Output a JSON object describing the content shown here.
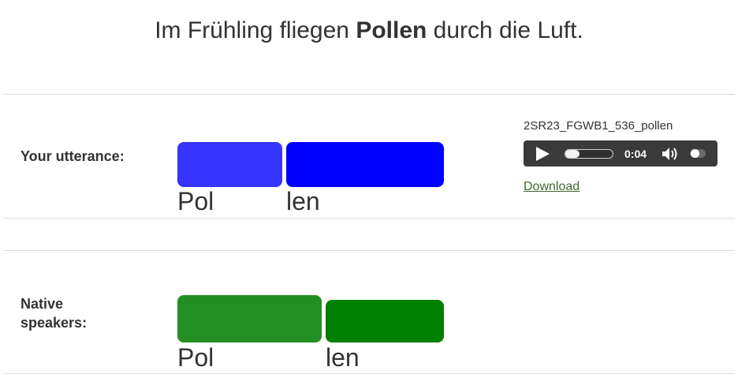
{
  "sentence": {
    "before": "Im Frühling fliegen ",
    "highlight": "Pollen",
    "after": " durch die Luft."
  },
  "utterance": {
    "label": "Your utterance:",
    "segments": [
      {
        "syllable": "Pol",
        "color": "#3535ff"
      },
      {
        "syllable": "len",
        "color": "#0000ff"
      }
    ]
  },
  "native": {
    "label_line1": "Native",
    "label_line2": "speakers:",
    "segments": [
      {
        "syllable": "Pol",
        "color": "#238e23"
      },
      {
        "syllable": "len",
        "color": "#008000"
      }
    ]
  },
  "audio": {
    "filename": "2SR23_FGWB1_536_pollen",
    "time": "0:04",
    "progress": 0.3,
    "download_label": "Download"
  }
}
